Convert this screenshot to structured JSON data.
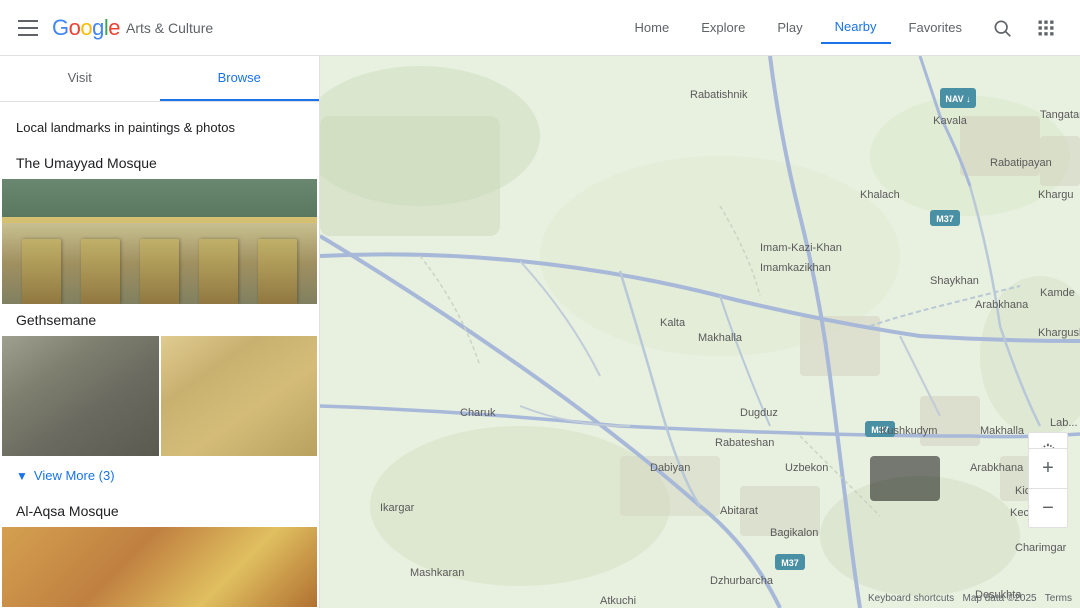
{
  "header": {
    "menu_label": "Menu",
    "logo_text": "Google",
    "logo_product": "Arts & Culture",
    "nav_items": [
      {
        "id": "home",
        "label": "Home",
        "active": false
      },
      {
        "id": "explore",
        "label": "Explore",
        "active": false
      },
      {
        "id": "play",
        "label": "Play",
        "active": false
      },
      {
        "id": "nearby",
        "label": "Nearby",
        "active": true
      },
      {
        "id": "favorites",
        "label": "Favorites",
        "active": false
      }
    ]
  },
  "sidebar": {
    "tabs": [
      {
        "id": "visit",
        "label": "Visit",
        "active": false
      },
      {
        "id": "browse",
        "label": "Browse",
        "active": true
      }
    ],
    "section_title": "Local landmarks in paintings & photos",
    "landmarks": [
      {
        "id": "umayyad",
        "title": "The Umayyad Mosque"
      },
      {
        "id": "gethsemane",
        "title": "Gethsemane"
      }
    ],
    "view_more_label": "View More (3)",
    "aqsa_title": "Al-Aqsa Mosque"
  },
  "map": {
    "locations": {
      "kavala": "Kavala",
      "tangatar": "Tangatar",
      "rabatishnik": "Rabatishnik",
      "khalach": "Khalach",
      "khargu": "Khargu",
      "imam_kazi_khan": "Imam-Kazi-Khan",
      "imamkazikh an": "Imamkazikhan",
      "shaykhan": "Shaykhan",
      "arabkhana": "Arabkhana",
      "kamde": "Kamde",
      "khargush": "Khargush",
      "kalta": "Kalta",
      "makhalla_top": "Makhalla",
      "charuk": "Charuk",
      "dugduz": "Dugduz",
      "kushkudym": "Kushkudym",
      "makhalla_btm": "Makhalla",
      "rabateshan": "Rabateshan",
      "dabiyan": "Dabiyan",
      "uzbekon": "Uzbekon",
      "ikargar": "Ikargar",
      "abitarat": "Abitarat",
      "bagikalon": "Bagikalon",
      "kechkunak": "Kechkunak",
      "kichikbay": "Kichikbay",
      "arabkhana_btm": "Arabkhana",
      "charimgar": "Charimgar",
      "mashkaran": "Mashkaran",
      "dzhurbarcha": "Dzhurbarcha",
      "atkuchi": "Atkuchi",
      "desukhta": "Desukhta",
      "m37_top": "M37",
      "m37_mid": "M37",
      "m37_btm": "M37",
      "nav_label": "NAV",
      "labi": "Lab..."
    },
    "attribution": {
      "keyboard": "Keyboard shortcuts",
      "map_data": "Map data ©2025",
      "terms": "Terms"
    },
    "zoom_in_label": "+",
    "zoom_out_label": "−"
  }
}
